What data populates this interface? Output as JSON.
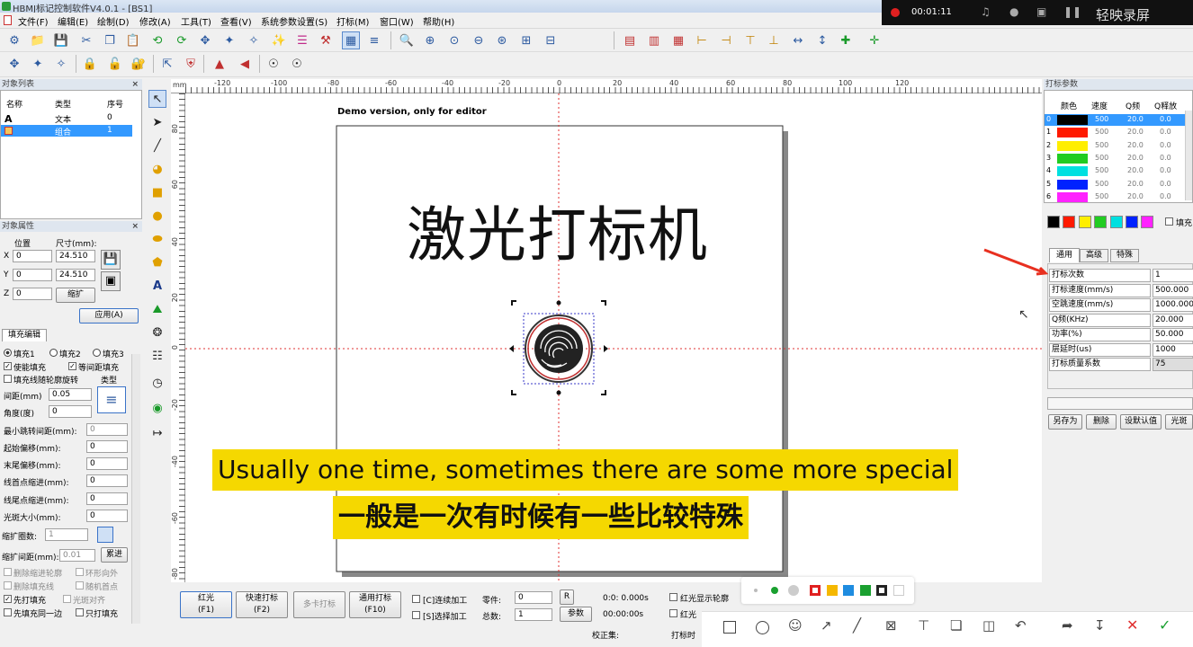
{
  "window": {
    "title": "HBMJ标记控制软件V4.0.1 - [BS1]"
  },
  "menu": [
    "文件(F)",
    "编辑(E)",
    "绘制(D)",
    "修改(A)",
    "工具(T)",
    "查看(V)",
    "系统参数设置(S)",
    "打标(M)",
    "窗口(W)",
    "帮助(H)"
  ],
  "recorder": {
    "time": "00:01:11",
    "brand": "轻映录屏"
  },
  "object_list": {
    "title": "对象列表",
    "columns": [
      "名称",
      "类型",
      "序号"
    ],
    "rows": [
      {
        "type": "文本",
        "index": "0"
      },
      {
        "type": "组合",
        "index": "1"
      }
    ]
  },
  "object_props": {
    "title": "对象属性",
    "position_label": "位置",
    "size_label": "尺寸(mm):",
    "x_label": "X",
    "x_value": "0",
    "w_value": "24.510",
    "y_label": "Y",
    "y_value": "0",
    "h_value": "24.510",
    "z_label": "Z",
    "z_value": "0",
    "scale_button": "缩扩",
    "apply_button": "应用(A)"
  },
  "fill_edit": {
    "tab": "填充编辑",
    "fill1": "填充1",
    "fill2": "填充2",
    "fill3": "填充3",
    "enable_fill": "使能填充",
    "equal_spacing": "等间距填充",
    "follow_outline": "填充线随轮廓旋转",
    "type_label": "类型",
    "spacing_label": "间距(mm)",
    "spacing_value": "0.05",
    "angle_label": "角度(度)",
    "angle_value": "0",
    "min_jump_label": "最小跳转间距(mm):",
    "min_jump_value": "0",
    "start_offset_label": "起始偏移(mm):",
    "start_offset_value": "0",
    "end_offset_label": "末尾偏移(mm):",
    "end_offset_value": "0",
    "line_start_label": "线首点缩进(mm):",
    "line_start_value": "0",
    "line_end_label": "线尾点缩进(mm):",
    "line_end_value": "0",
    "spot_label": "光斑大小(mm):",
    "spot_value": "0",
    "ring_count_label": "缩扩圈数:",
    "ring_count_value": "1",
    "ring_spacing_label": "缩扩间距(mm):",
    "ring_spacing_value": "0.01",
    "accumulate_button": "累进",
    "remove_outline": "删除缩进轮廓",
    "ring_outward": "环形向外",
    "remove_fill_line": "删除填充线",
    "random_start": "随机首点",
    "mark_first": "先打填充",
    "spot_align": "光斑对齐",
    "fill_same_side": "先填充同一边",
    "fill_only": "只打填充"
  },
  "canvas": {
    "demo_text": "Demo version, only for editor",
    "main_text": "激光打标机",
    "ruler_top": [
      "-120",
      "-100",
      "-80",
      "-60",
      "-40",
      "-20",
      "0",
      "20",
      "40",
      "60",
      "80",
      "100",
      "120"
    ],
    "ruler_left": [
      "80",
      "60",
      "40",
      "20",
      "0",
      "-20",
      "-40",
      "-60",
      "-80"
    ],
    "ruler_unit": "mm"
  },
  "mark_params": {
    "title": "打标参数",
    "columns": [
      "颜色",
      "速度",
      "Q频",
      "Q释放"
    ],
    "rows": [
      {
        "id": "0",
        "color": "#000000",
        "speed": "500",
        "q": "20.0",
        "qr": "0.0"
      },
      {
        "id": "1",
        "color": "#ff1a00",
        "speed": "500",
        "q": "20.0",
        "qr": "0.0"
      },
      {
        "id": "2",
        "color": "#ffee00",
        "speed": "500",
        "q": "20.0",
        "qr": "0.0"
      },
      {
        "id": "3",
        "color": "#22cc22",
        "speed": "500",
        "q": "20.0",
        "qr": "0.0"
      },
      {
        "id": "4",
        "color": "#00e0e0",
        "speed": "500",
        "q": "20.0",
        "qr": "0.0"
      },
      {
        "id": "5",
        "color": "#0022ff",
        "speed": "500",
        "q": "20.0",
        "qr": "0.0"
      },
      {
        "id": "6",
        "color": "#ff22ff",
        "speed": "500",
        "q": "20.0",
        "qr": "0.0"
      }
    ],
    "swatches": [
      "#000000",
      "#ff1a00",
      "#ffee00",
      "#22cc22",
      "#00e0e0",
      "#0022ff",
      "#ff22ff"
    ],
    "fill_label": "填充",
    "tabs": [
      "通用",
      "高级",
      "特殊"
    ],
    "props": [
      {
        "name": "打标次数",
        "value": "1"
      },
      {
        "name": "打标速度(mm/s)",
        "value": "500.000"
      },
      {
        "name": "空跳速度(mm/s)",
        "value": "1000.000"
      },
      {
        "name": "Q频(KHz)",
        "value": "20.000"
      },
      {
        "name": "功率(%)",
        "value": "50.000"
      },
      {
        "name": "层延时(us)",
        "value": "1000"
      },
      {
        "name": "打标质量系数",
        "value": "75"
      }
    ],
    "buttons": [
      "另存为",
      "删除",
      "设默认值",
      "光斑"
    ]
  },
  "bottom": {
    "red_light": "红光",
    "red_key": "(F1)",
    "quick_mark": "快速打标",
    "quick_key": "(F2)",
    "multi_mark": "多卡打标",
    "general_mark": "通用打标",
    "general_key": "(F10)",
    "continuous": "[C]连续加工",
    "select_process": "[S]选择加工",
    "parts_label": "零件:",
    "parts_value": "0",
    "total_label": "总数:",
    "total_value": "1",
    "r_button": "R",
    "params_button": "参数",
    "time1": "0:0: 0.000s",
    "time2": "00:00:00s",
    "red_outline": "红光显示轮廓",
    "red_light2": "红光",
    "calib": "校正集:",
    "mark_time": "打标时"
  },
  "subtitles": {
    "en": "Usually one time, sometimes there are some more special",
    "zh": "一般是一次有时候有一些比较特殊"
  },
  "palette_colors": [
    "#e02020",
    "#f5b800",
    "#1e8ce0",
    "#1aa030",
    "#222222",
    "#ffffff"
  ]
}
